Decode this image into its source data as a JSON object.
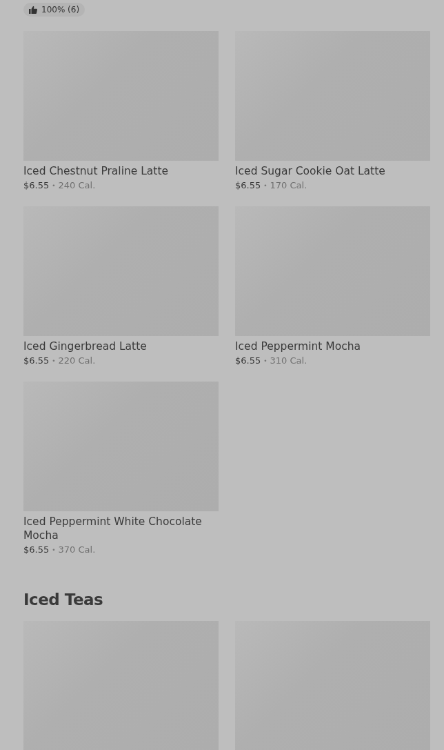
{
  "rating_badge": {
    "text": "100% (6)"
  },
  "sections": [
    {
      "items": [
        {
          "kind": "product",
          "name": "Iced Chestnut Praline Latte",
          "price": "$6.55",
          "separator": "•",
          "calories": "240 Cal."
        },
        {
          "kind": "product",
          "name": "Iced Sugar Cookie Oat Latte",
          "price": "$6.55",
          "separator": "•",
          "calories": "170 Cal."
        },
        {
          "kind": "product",
          "name": "Iced Gingerbread Latte",
          "price": "$6.55",
          "separator": "•",
          "calories": "220 Cal."
        },
        {
          "kind": "product",
          "name": "Iced Peppermint Mocha",
          "price": "$6.55",
          "separator": "•",
          "calories": "310 Cal."
        },
        {
          "kind": "product",
          "name": "Iced Peppermint White Chocolate Mocha",
          "price": "$6.55",
          "separator": "•",
          "calories": "370 Cal."
        }
      ]
    },
    {
      "title": "Iced Teas",
      "items": [
        {
          "kind": "image_only"
        },
        {
          "kind": "image_only"
        }
      ]
    }
  ]
}
